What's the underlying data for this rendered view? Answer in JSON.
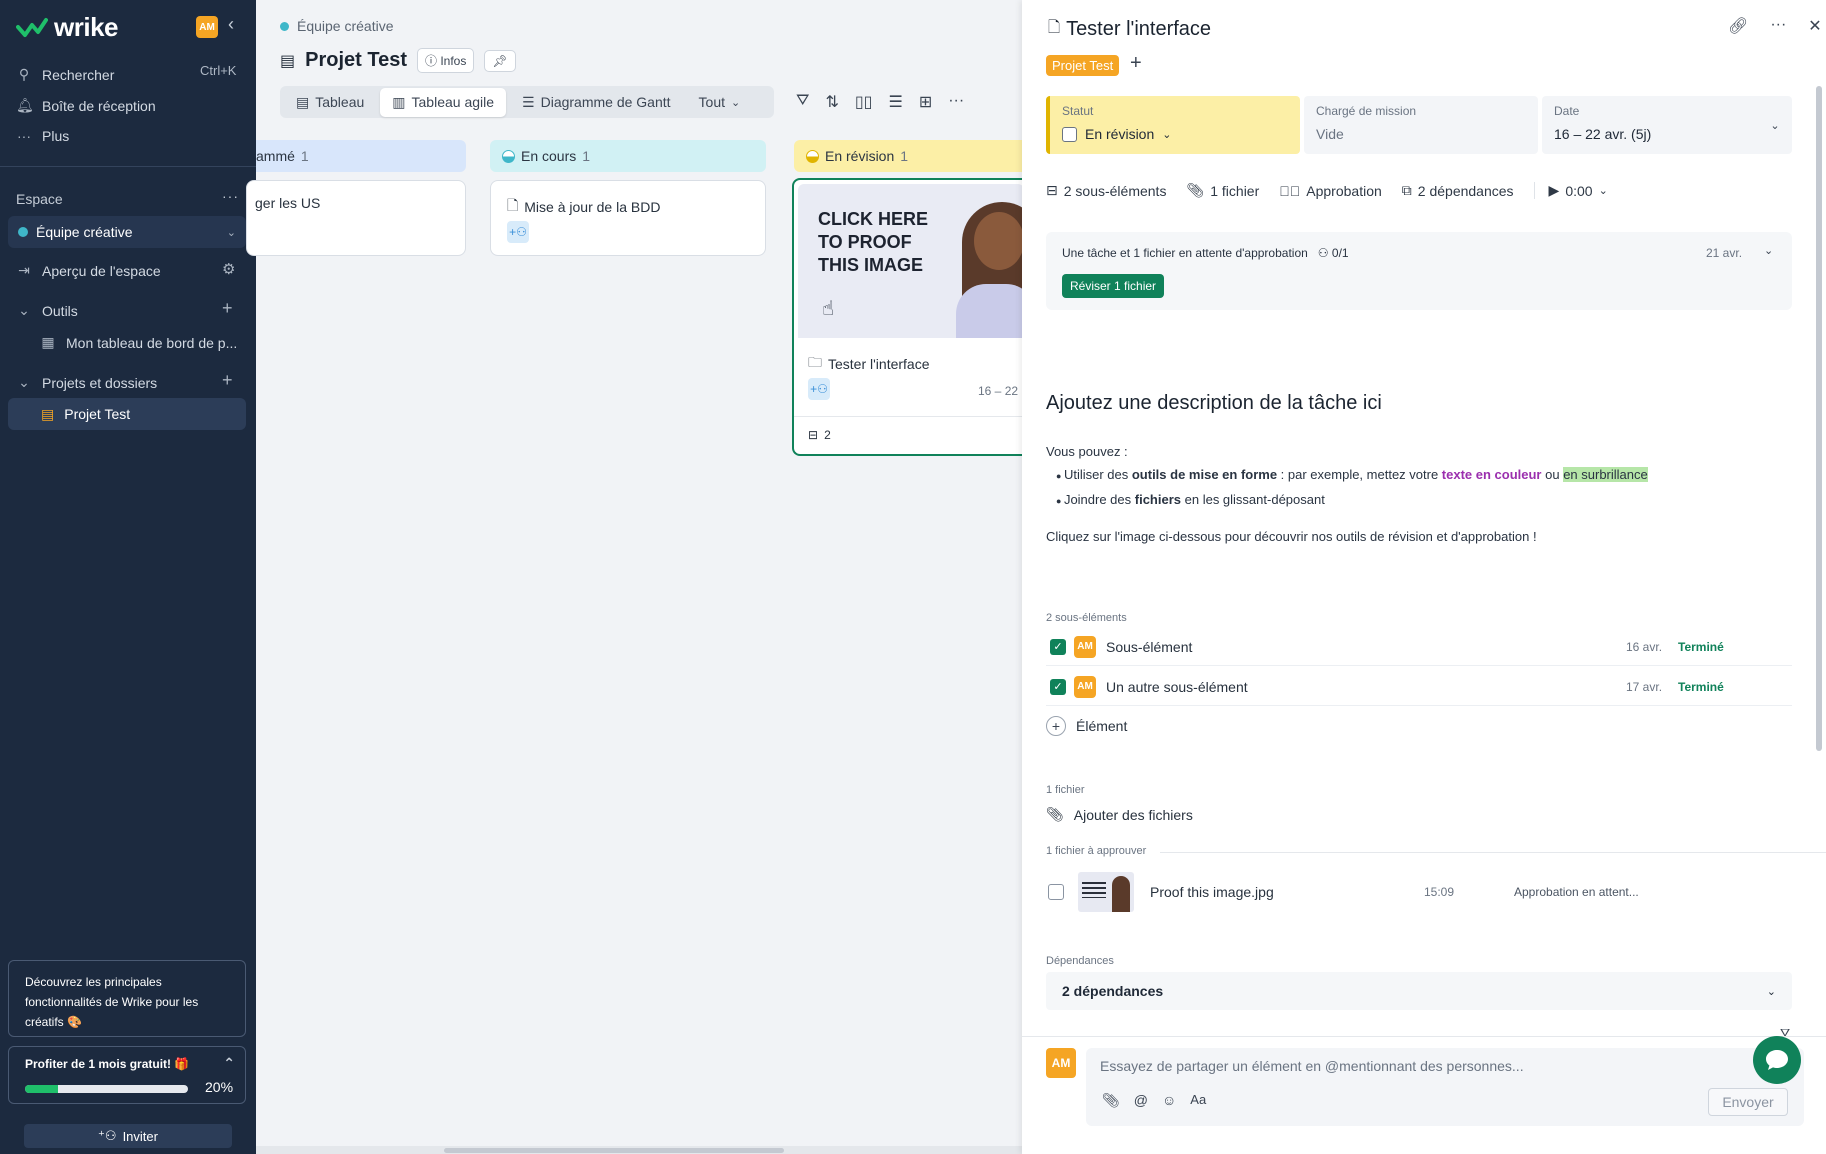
{
  "sidebar": {
    "logo": "wrike",
    "avatar": "AM",
    "search_label": "Rechercher",
    "search_shortcut": "Ctrl+K",
    "inbox_label": "Boîte de réception",
    "more_label": "Plus",
    "space_section": "Espace",
    "space_selected": "Équipe créative",
    "space_overview": "Aperçu de l'espace",
    "tools_label": "Outils",
    "dashboard_item": "Mon tableau de bord de p...",
    "projects_label": "Projets et dossiers",
    "active_project": "Projet Test",
    "promo_text": "Découvrez les principales fonctionnalités de Wrike pour les créatifs 🎨",
    "trial_text": "Profiter de 1 mois gratuit! 🎁",
    "trial_progress": 0.2,
    "trial_percent": "20%",
    "invite_label": "Inviter"
  },
  "main": {
    "breadcrumb": "Équipe créative",
    "title": "Projet Test",
    "info_label": "Infos",
    "views": [
      "Tableau",
      "Tableau agile",
      "Diagramme de Gantt"
    ],
    "active_view": "Tableau agile",
    "filter_label": "Tout",
    "columns": [
      {
        "label": "ammé",
        "count": "1",
        "card_title": "ger les US"
      },
      {
        "label": "En cours",
        "count": "1",
        "card_title": "Mise à jour de la BDD"
      },
      {
        "label": "En révision",
        "count": "1",
        "card_title": "Tester l'interface",
        "card_dates": "16 – 22",
        "subtasks": "2",
        "proof_text": "CLICK HERE TO PROOF THIS IMAGE"
      }
    ]
  },
  "panel": {
    "title": "Tester l'interface",
    "tag": "Projet Test",
    "status_label": "Statut",
    "status_value": "En révision",
    "assignee_label": "Chargé de mission",
    "assignee_value": "Vide",
    "date_label": "Date",
    "date_value": "16 – 22 avr. (5j)",
    "meta": {
      "subtasks": "2 sous-éléments",
      "files": "1 fichier",
      "approval": "Approbation",
      "dependencies": "2 dépendances",
      "timer": "0:00"
    },
    "approval_box": {
      "text": "Une tâche et 1 fichier en attente d'approbation",
      "count": "0/1",
      "date": "21 avr.",
      "button": "Réviser 1 fichier"
    },
    "description": {
      "heading": "Ajoutez une description de la tâche ici",
      "intro": "Vous pouvez :",
      "b1_a": "Utiliser des ",
      "b1_bold": "outils de mise en forme",
      "b1_b": " : par exemple, mettez votre ",
      "b1_color": "texte en couleur",
      "b1_c": " ou ",
      "b1_hl": "en surbrillance",
      "b2_a": "Joindre des ",
      "b2_bold": "fichiers",
      "b2_b": " en les glissant-déposant",
      "outro": "Cliquez sur l'image ci-dessous pour découvrir nos outils de révision et d'approbation !"
    },
    "subtasks_label": "2 sous-éléments",
    "subtasks": [
      {
        "avatar": "AM",
        "title": "Sous-élément",
        "date": "16 avr.",
        "status": "Terminé"
      },
      {
        "avatar": "AM",
        "title": "Un autre sous-élément",
        "date": "17 avr.",
        "status": "Terminé"
      }
    ],
    "add_item": "Élément",
    "files_label": "1 fichier",
    "add_files": "Ajouter des fichiers",
    "to_approve_label": "1 fichier à approuver",
    "file": {
      "name": "Proof this image.jpg",
      "time": "15:09",
      "status": "Approbation en attent..."
    },
    "deps_label": "Dépendances",
    "deps_value": "2 dépendances",
    "comment_avatar": "AM",
    "comment_placeholder": "Essayez de partager un élément en @mentionnant des personnes...",
    "send_label": "Envoyer"
  },
  "colors": {
    "sidebar": "#1c2a3f",
    "accent_green": "#10825a",
    "tag_orange": "#f5a524",
    "review_yellow": "#fcefa6"
  }
}
